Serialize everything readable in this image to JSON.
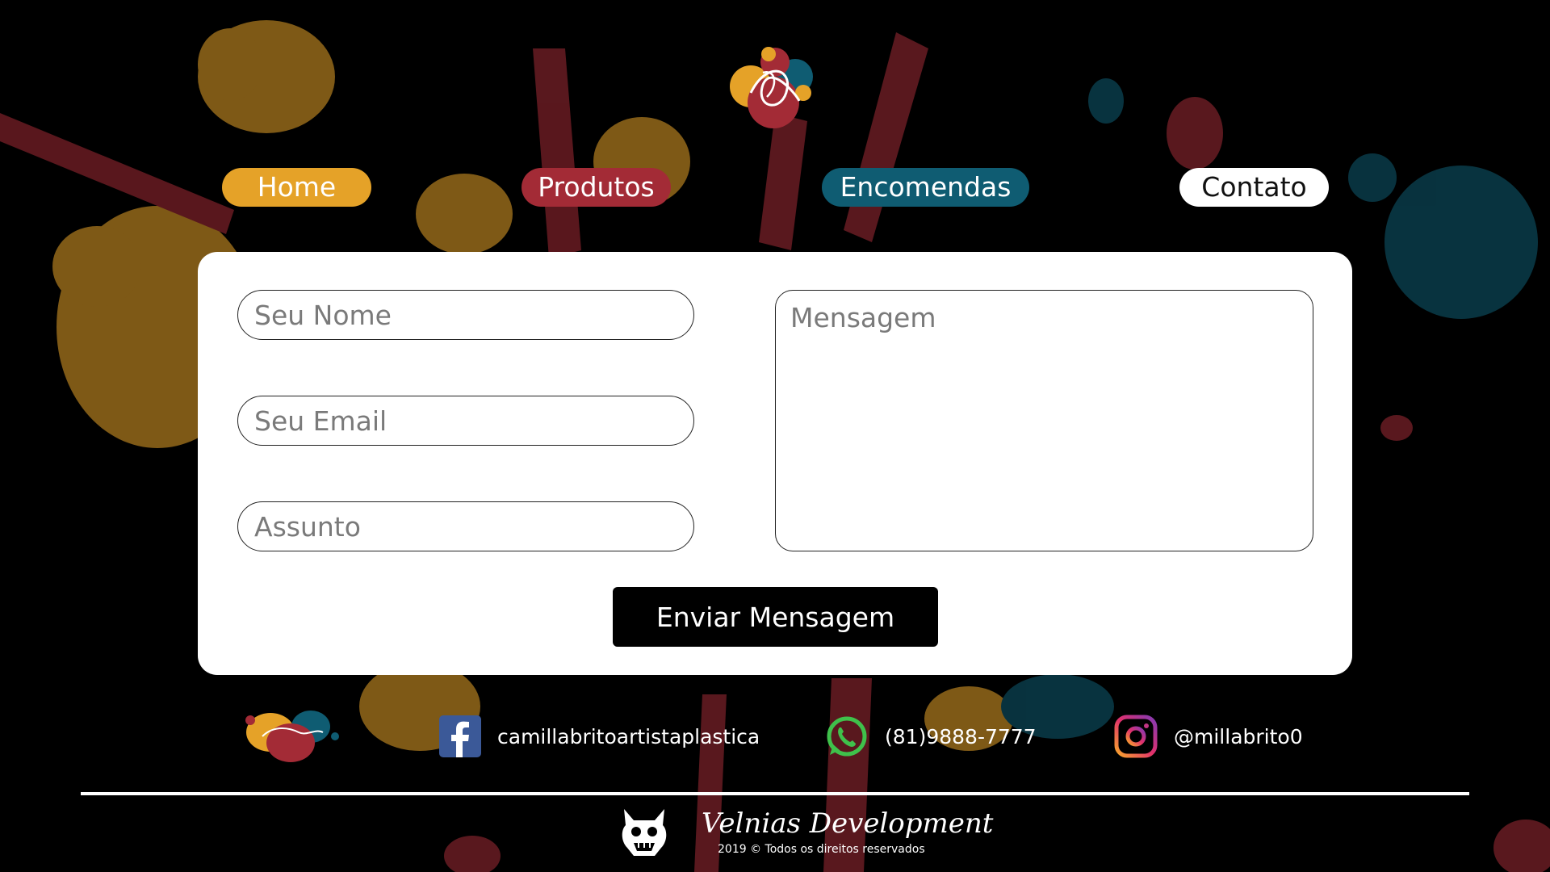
{
  "colors": {
    "background": "#000000",
    "accent_yellow": "#e5a228",
    "accent_red": "#a32b36",
    "accent_teal": "#0f5c72",
    "white": "#ffffff"
  },
  "header": {
    "logo_icon": "artist-paint-splash-logo"
  },
  "nav": {
    "items": [
      {
        "label": "Home",
        "color": "#e5a228"
      },
      {
        "label": "Produtos",
        "color": "#a32b36"
      },
      {
        "label": "Encomendas",
        "color": "#0f5c72"
      },
      {
        "label": "Contato",
        "color": "#ffffff"
      }
    ]
  },
  "form": {
    "name_placeholder": "Seu Nome",
    "email_placeholder": "Seu Email",
    "subject_placeholder": "Assunto",
    "message_placeholder": "Mensagem",
    "submit_label": "Enviar Mensagem"
  },
  "footer": {
    "facebook": {
      "icon": "facebook-icon",
      "label": "camillabritoartistaplastica"
    },
    "whatsapp": {
      "icon": "whatsapp-icon",
      "label": "(81)9888-7777"
    },
    "instagram": {
      "icon": "instagram-icon",
      "label": "@millabrito0"
    },
    "developer": {
      "name": "Velnias Development",
      "copyright": "2019 © Todos os direitos reservados",
      "icon": "demon-mask-icon"
    }
  }
}
